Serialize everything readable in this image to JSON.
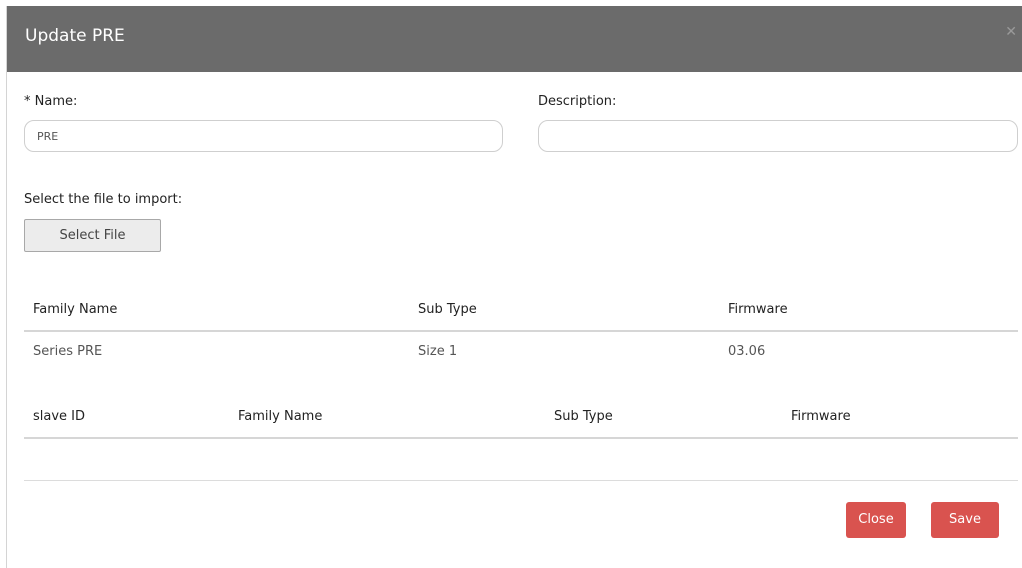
{
  "modal": {
    "title": "Update PRE",
    "close_icon": "close-icon"
  },
  "form": {
    "name_label": "* Name:",
    "name_value": "PRE",
    "description_label": "Description:",
    "description_value": "",
    "file_label": "Select the file to import:",
    "select_file_button": "Select File"
  },
  "device_table": {
    "headers": [
      "Family Name",
      "Sub Type",
      "Firmware"
    ],
    "rows": [
      [
        "Series PRE",
        "Size 1",
        "03.06"
      ]
    ]
  },
  "slave_table": {
    "headers": [
      "slave ID",
      "Family Name",
      "Sub Type",
      "Firmware"
    ],
    "rows": []
  },
  "footer": {
    "close_label": "Close",
    "save_label": "Save",
    "button_color": "#d9534f"
  },
  "colors": {
    "header_bg": "#6b6b6b"
  }
}
